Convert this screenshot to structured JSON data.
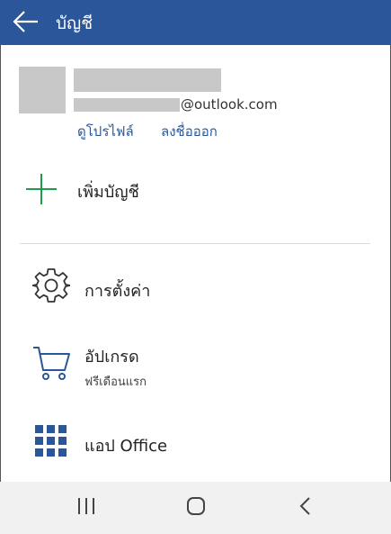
{
  "header": {
    "title": "บัญชี",
    "back_icon": "arrow-left-icon",
    "background": "#2b579a"
  },
  "account": {
    "email_domain": "@outlook.com",
    "edit_profile_label": "ดูโปรไฟล์",
    "sign_out_label": "ลงชื่อออก"
  },
  "add_account": {
    "label": "เพิ่มบัญชี",
    "icon": "plus-icon",
    "icon_color": "#1e9c4a"
  },
  "menu": {
    "settings": {
      "label": "การตั้งค่า",
      "icon": "gear-icon"
    },
    "upgrade": {
      "label": "อัปเกรด",
      "sublabel": "ฟรีเดือนแรก",
      "icon": "cart-icon"
    },
    "office_apps": {
      "label": "แอป Office",
      "icon": "app-grid-icon"
    }
  },
  "navbar": {
    "recent_icon": "recent-apps-icon",
    "home_icon": "home-icon",
    "back_icon": "back-chevron-icon"
  },
  "colors": {
    "accent": "#2b579a",
    "green": "#1e9c4a",
    "placeholder": "#c8c8c8"
  }
}
